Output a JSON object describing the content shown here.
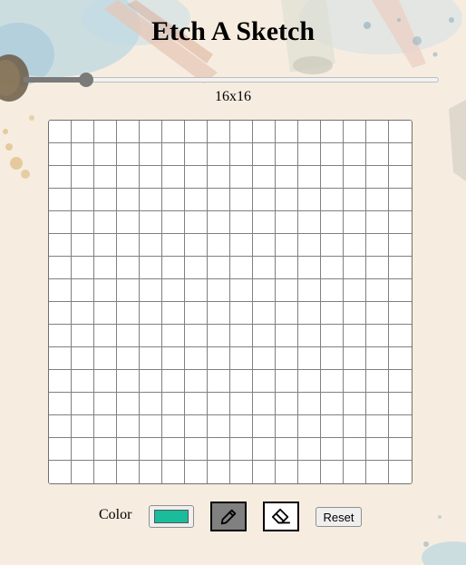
{
  "page": {
    "title": "Etch A Sketch"
  },
  "grid": {
    "size_label": "16x16",
    "size_value": 16,
    "slider_min": 1,
    "slider_max": 100,
    "rows": 16,
    "cols": 16,
    "cell_color": "#ffffff",
    "line_color": "#808080"
  },
  "controls": {
    "color_label": "Color",
    "selected_color": "#1abc9c",
    "pen_icon": "pencil-icon",
    "eraser_icon": "eraser-icon",
    "reset_label": "Reset",
    "active_tool": "pen"
  },
  "theme": {
    "background": "#f6ede0",
    "active_tool_bg": "#808080"
  }
}
